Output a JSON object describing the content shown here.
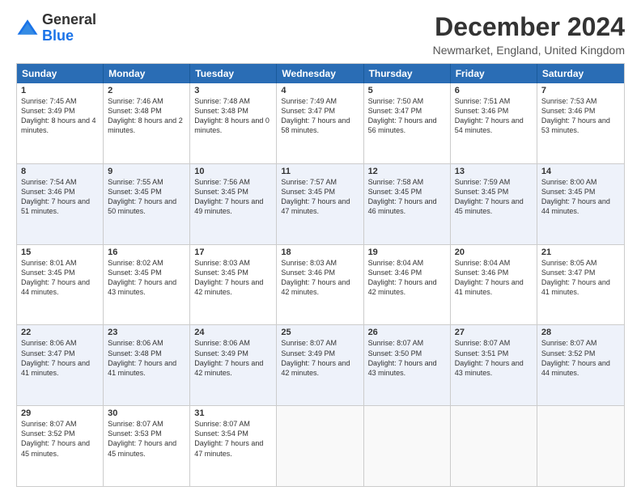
{
  "header": {
    "logo_line1": "General",
    "logo_line2": "Blue",
    "title": "December 2024",
    "subtitle": "Newmarket, England, United Kingdom"
  },
  "days_of_week": [
    "Sunday",
    "Monday",
    "Tuesday",
    "Wednesday",
    "Thursday",
    "Friday",
    "Saturday"
  ],
  "weeks": [
    [
      {
        "day": "1",
        "sunrise": "Sunrise: 7:45 AM",
        "sunset": "Sunset: 3:49 PM",
        "daylight": "Daylight: 8 hours and 4 minutes."
      },
      {
        "day": "2",
        "sunrise": "Sunrise: 7:46 AM",
        "sunset": "Sunset: 3:48 PM",
        "daylight": "Daylight: 8 hours and 2 minutes."
      },
      {
        "day": "3",
        "sunrise": "Sunrise: 7:48 AM",
        "sunset": "Sunset: 3:48 PM",
        "daylight": "Daylight: 8 hours and 0 minutes."
      },
      {
        "day": "4",
        "sunrise": "Sunrise: 7:49 AM",
        "sunset": "Sunset: 3:47 PM",
        "daylight": "Daylight: 7 hours and 58 minutes."
      },
      {
        "day": "5",
        "sunrise": "Sunrise: 7:50 AM",
        "sunset": "Sunset: 3:47 PM",
        "daylight": "Daylight: 7 hours and 56 minutes."
      },
      {
        "day": "6",
        "sunrise": "Sunrise: 7:51 AM",
        "sunset": "Sunset: 3:46 PM",
        "daylight": "Daylight: 7 hours and 54 minutes."
      },
      {
        "day": "7",
        "sunrise": "Sunrise: 7:53 AM",
        "sunset": "Sunset: 3:46 PM",
        "daylight": "Daylight: 7 hours and 53 minutes."
      }
    ],
    [
      {
        "day": "8",
        "sunrise": "Sunrise: 7:54 AM",
        "sunset": "Sunset: 3:46 PM",
        "daylight": "Daylight: 7 hours and 51 minutes."
      },
      {
        "day": "9",
        "sunrise": "Sunrise: 7:55 AM",
        "sunset": "Sunset: 3:45 PM",
        "daylight": "Daylight: 7 hours and 50 minutes."
      },
      {
        "day": "10",
        "sunrise": "Sunrise: 7:56 AM",
        "sunset": "Sunset: 3:45 PM",
        "daylight": "Daylight: 7 hours and 49 minutes."
      },
      {
        "day": "11",
        "sunrise": "Sunrise: 7:57 AM",
        "sunset": "Sunset: 3:45 PM",
        "daylight": "Daylight: 7 hours and 47 minutes."
      },
      {
        "day": "12",
        "sunrise": "Sunrise: 7:58 AM",
        "sunset": "Sunset: 3:45 PM",
        "daylight": "Daylight: 7 hours and 46 minutes."
      },
      {
        "day": "13",
        "sunrise": "Sunrise: 7:59 AM",
        "sunset": "Sunset: 3:45 PM",
        "daylight": "Daylight: 7 hours and 45 minutes."
      },
      {
        "day": "14",
        "sunrise": "Sunrise: 8:00 AM",
        "sunset": "Sunset: 3:45 PM",
        "daylight": "Daylight: 7 hours and 44 minutes."
      }
    ],
    [
      {
        "day": "15",
        "sunrise": "Sunrise: 8:01 AM",
        "sunset": "Sunset: 3:45 PM",
        "daylight": "Daylight: 7 hours and 44 minutes."
      },
      {
        "day": "16",
        "sunrise": "Sunrise: 8:02 AM",
        "sunset": "Sunset: 3:45 PM",
        "daylight": "Daylight: 7 hours and 43 minutes."
      },
      {
        "day": "17",
        "sunrise": "Sunrise: 8:03 AM",
        "sunset": "Sunset: 3:45 PM",
        "daylight": "Daylight: 7 hours and 42 minutes."
      },
      {
        "day": "18",
        "sunrise": "Sunrise: 8:03 AM",
        "sunset": "Sunset: 3:46 PM",
        "daylight": "Daylight: 7 hours and 42 minutes."
      },
      {
        "day": "19",
        "sunrise": "Sunrise: 8:04 AM",
        "sunset": "Sunset: 3:46 PM",
        "daylight": "Daylight: 7 hours and 42 minutes."
      },
      {
        "day": "20",
        "sunrise": "Sunrise: 8:04 AM",
        "sunset": "Sunset: 3:46 PM",
        "daylight": "Daylight: 7 hours and 41 minutes."
      },
      {
        "day": "21",
        "sunrise": "Sunrise: 8:05 AM",
        "sunset": "Sunset: 3:47 PM",
        "daylight": "Daylight: 7 hours and 41 minutes."
      }
    ],
    [
      {
        "day": "22",
        "sunrise": "Sunrise: 8:06 AM",
        "sunset": "Sunset: 3:47 PM",
        "daylight": "Daylight: 7 hours and 41 minutes."
      },
      {
        "day": "23",
        "sunrise": "Sunrise: 8:06 AM",
        "sunset": "Sunset: 3:48 PM",
        "daylight": "Daylight: 7 hours and 41 minutes."
      },
      {
        "day": "24",
        "sunrise": "Sunrise: 8:06 AM",
        "sunset": "Sunset: 3:49 PM",
        "daylight": "Daylight: 7 hours and 42 minutes."
      },
      {
        "day": "25",
        "sunrise": "Sunrise: 8:07 AM",
        "sunset": "Sunset: 3:49 PM",
        "daylight": "Daylight: 7 hours and 42 minutes."
      },
      {
        "day": "26",
        "sunrise": "Sunrise: 8:07 AM",
        "sunset": "Sunset: 3:50 PM",
        "daylight": "Daylight: 7 hours and 43 minutes."
      },
      {
        "day": "27",
        "sunrise": "Sunrise: 8:07 AM",
        "sunset": "Sunset: 3:51 PM",
        "daylight": "Daylight: 7 hours and 43 minutes."
      },
      {
        "day": "28",
        "sunrise": "Sunrise: 8:07 AM",
        "sunset": "Sunset: 3:52 PM",
        "daylight": "Daylight: 7 hours and 44 minutes."
      }
    ],
    [
      {
        "day": "29",
        "sunrise": "Sunrise: 8:07 AM",
        "sunset": "Sunset: 3:52 PM",
        "daylight": "Daylight: 7 hours and 45 minutes."
      },
      {
        "day": "30",
        "sunrise": "Sunrise: 8:07 AM",
        "sunset": "Sunset: 3:53 PM",
        "daylight": "Daylight: 7 hours and 45 minutes."
      },
      {
        "day": "31",
        "sunrise": "Sunrise: 8:07 AM",
        "sunset": "Sunset: 3:54 PM",
        "daylight": "Daylight: 7 hours and 47 minutes."
      },
      {
        "day": "",
        "sunrise": "",
        "sunset": "",
        "daylight": ""
      },
      {
        "day": "",
        "sunrise": "",
        "sunset": "",
        "daylight": ""
      },
      {
        "day": "",
        "sunrise": "",
        "sunset": "",
        "daylight": ""
      },
      {
        "day": "",
        "sunrise": "",
        "sunset": "",
        "daylight": ""
      }
    ]
  ],
  "colors": {
    "header_bg": "#2a6db5",
    "header_text": "#ffffff",
    "alt_row_bg": "#eef2fa",
    "empty_bg": "#f9f9f9"
  }
}
